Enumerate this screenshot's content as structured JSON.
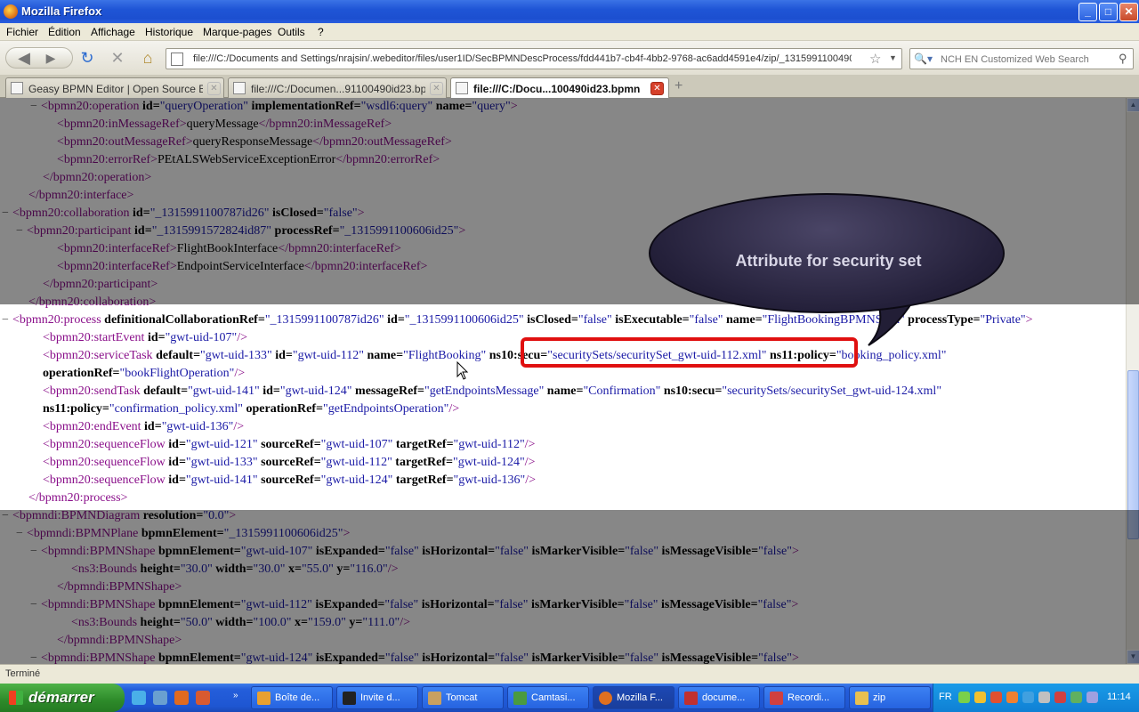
{
  "window": {
    "title": "Mozilla Firefox",
    "minimize": "_",
    "maximize": "□",
    "close": "✕"
  },
  "menu": [
    "Fichier",
    "Édition",
    "Affichage",
    "Historique",
    "Marque-pages",
    "Outils",
    "?"
  ],
  "nav": {
    "url": "file:///C:/Documents and Settings/nrajsin/.webeditor/files/user1ID/SecBPMNDescProcess/fdd441b7-cb4f-4bb2-9768-ac6add4591e4/zip/_1315991100490id23",
    "search_placeholder": "NCH EN Customized Web Search"
  },
  "tabs": [
    {
      "label": "Geasy BPMN Editor | Open Source BPM..."
    },
    {
      "label": "file:///C:/Documen...91100490id23.bpmn"
    },
    {
      "label": "file:///C:/Docu...100490id23.bpmn"
    }
  ],
  "callout": {
    "text": "Attribute for security set"
  },
  "status": "Terminé",
  "taskbar": {
    "start": "démarrer",
    "buttons": [
      "Boîte de...",
      "Invite d...",
      "Tomcat",
      "Camtasi...",
      "Mozilla F...",
      "docume...",
      "Recordi...",
      "zip"
    ],
    "lang": "FR",
    "clock": "11:14"
  },
  "lines": [
    {
      "m": "−",
      "t": [
        [
          "t",
          "<bpmn20:operation"
        ],
        [
          "a",
          " id="
        ],
        [
          "v",
          "\"queryOperation\""
        ],
        [
          "a",
          " implementationRef="
        ],
        [
          "v",
          "\"wsdl6:query\""
        ],
        [
          "a",
          " name="
        ],
        [
          "v",
          "\"query\""
        ],
        [
          "t",
          ">"
        ]
      ]
    },
    {
      "m": "",
      "t": [
        [
          "t",
          "<bpmn20:inMessageRef>"
        ],
        [
          "x",
          "queryMessage"
        ],
        [
          "t",
          "</bpmn20:inMessageRef>"
        ]
      ]
    },
    {
      "m": "",
      "t": [
        [
          "t",
          "<bpmn20:outMessageRef>"
        ],
        [
          "x",
          "queryResponseMessage"
        ],
        [
          "t",
          "</bpmn20:outMessageRef>"
        ]
      ]
    },
    {
      "m": "",
      "t": [
        [
          "t",
          "<bpmn20:errorRef>"
        ],
        [
          "x",
          "PEtALSWebServiceExceptionError"
        ],
        [
          "t",
          "</bpmn20:errorRef>"
        ]
      ]
    },
    {
      "m": "",
      "t": [
        [
          "t",
          "</bpmn20:operation>"
        ]
      ]
    },
    {
      "m": "",
      "t": [
        [
          "t",
          "</bpmn20:interface>"
        ]
      ]
    },
    {
      "m": "−",
      "t": [
        [
          "t",
          "<bpmn20:collaboration"
        ],
        [
          "a",
          " id="
        ],
        [
          "v",
          "\"_1315991100787id26\""
        ],
        [
          "a",
          " isClosed="
        ],
        [
          "v",
          "\"false\""
        ],
        [
          "t",
          ">"
        ]
      ]
    },
    {
      "m": "−",
      "t": [
        [
          "t",
          "<bpmn20:participant"
        ],
        [
          "a",
          " id="
        ],
        [
          "v",
          "\"_1315991572824id87\""
        ],
        [
          "a",
          " processRef="
        ],
        [
          "v",
          "\"_1315991100606id25\""
        ],
        [
          "t",
          ">"
        ]
      ]
    },
    {
      "m": "",
      "t": [
        [
          "t",
          "<bpmn20:interfaceRef>"
        ],
        [
          "x",
          "FlightBookInterface"
        ],
        [
          "t",
          "</bpmn20:interfaceRef>"
        ]
      ]
    },
    {
      "m": "",
      "t": [
        [
          "t",
          "<bpmn20:interfaceRef>"
        ],
        [
          "x",
          "EndpointServiceInterface"
        ],
        [
          "t",
          "</bpmn20:interfaceRef>"
        ]
      ]
    },
    {
      "m": "",
      "t": [
        [
          "t",
          "</bpmn20:participant>"
        ]
      ]
    },
    {
      "m": "",
      "t": [
        [
          "t",
          "</bpmn20:collaboration>"
        ]
      ]
    },
    {
      "m": "−",
      "t": [
        [
          "t",
          "<bpmn20:process"
        ],
        [
          "a",
          " definitionalCollaborationRef="
        ],
        [
          "v",
          "\"_1315991100787id26\""
        ],
        [
          "a",
          " id="
        ],
        [
          "v",
          "\"_1315991100606id25\""
        ],
        [
          "a",
          " isClosed="
        ],
        [
          "v",
          "\"false\""
        ],
        [
          "a",
          " isExecutable="
        ],
        [
          "v",
          "\"false\""
        ],
        [
          "a",
          " name="
        ],
        [
          "v",
          "\"FlightBookingBPMNSecu\""
        ],
        [
          "a",
          " processType="
        ],
        [
          "v",
          "\"Private\""
        ],
        [
          "t",
          ">"
        ]
      ]
    },
    {
      "m": "",
      "t": [
        [
          "t",
          "<bpmn20:startEvent"
        ],
        [
          "a",
          " id="
        ],
        [
          "v",
          "\"gwt-uid-107\""
        ],
        [
          "t",
          "/>"
        ]
      ]
    },
    {
      "m": "",
      "t": [
        [
          "t",
          "<bpmn20:serviceTask"
        ],
        [
          "a",
          " default="
        ],
        [
          "v",
          "\"gwt-uid-133\""
        ],
        [
          "a",
          " id="
        ],
        [
          "v",
          "\"gwt-uid-112\""
        ],
        [
          "a",
          " name="
        ],
        [
          "v",
          "\"FlightBooking\""
        ],
        [
          "a",
          " ns10:secu="
        ],
        [
          "v",
          "\"securitySets/securitySet_gwt-uid-112.xml\""
        ],
        [
          "a",
          " ns11:policy="
        ],
        [
          "v",
          "\"booking_policy.xml\""
        ]
      ]
    },
    {
      "m": "",
      "t": [
        [
          "a",
          "operationRef="
        ],
        [
          "v",
          "\"bookFlightOperation\""
        ],
        [
          "t",
          "/>"
        ]
      ]
    },
    {
      "m": "",
      "t": [
        [
          "t",
          "<bpmn20:sendTask"
        ],
        [
          "a",
          " default="
        ],
        [
          "v",
          "\"gwt-uid-141\""
        ],
        [
          "a",
          " id="
        ],
        [
          "v",
          "\"gwt-uid-124\""
        ],
        [
          "a",
          " messageRef="
        ],
        [
          "v",
          "\"getEndpointsMessage\""
        ],
        [
          "a",
          " name="
        ],
        [
          "v",
          "\"Confirmation\""
        ],
        [
          "a",
          " ns10:secu="
        ],
        [
          "v",
          "\"securitySets/securitySet_gwt-uid-124.xml\""
        ]
      ]
    },
    {
      "m": "",
      "t": [
        [
          "a",
          "ns11:policy="
        ],
        [
          "v",
          "\"confirmation_policy.xml\""
        ],
        [
          "a",
          " operationRef="
        ],
        [
          "v",
          "\"getEndpointsOperation\""
        ],
        [
          "t",
          "/>"
        ]
      ]
    },
    {
      "m": "",
      "t": [
        [
          "t",
          "<bpmn20:endEvent"
        ],
        [
          "a",
          " id="
        ],
        [
          "v",
          "\"gwt-uid-136\""
        ],
        [
          "t",
          "/>"
        ]
      ]
    },
    {
      "m": "",
      "t": [
        [
          "t",
          "<bpmn20:sequenceFlow"
        ],
        [
          "a",
          " id="
        ],
        [
          "v",
          "\"gwt-uid-121\""
        ],
        [
          "a",
          " sourceRef="
        ],
        [
          "v",
          "\"gwt-uid-107\""
        ],
        [
          "a",
          " targetRef="
        ],
        [
          "v",
          "\"gwt-uid-112\""
        ],
        [
          "t",
          "/>"
        ]
      ]
    },
    {
      "m": "",
      "t": [
        [
          "t",
          "<bpmn20:sequenceFlow"
        ],
        [
          "a",
          " id="
        ],
        [
          "v",
          "\"gwt-uid-133\""
        ],
        [
          "a",
          " sourceRef="
        ],
        [
          "v",
          "\"gwt-uid-112\""
        ],
        [
          "a",
          " targetRef="
        ],
        [
          "v",
          "\"gwt-uid-124\""
        ],
        [
          "t",
          "/>"
        ]
      ]
    },
    {
      "m": "",
      "t": [
        [
          "t",
          "<bpmn20:sequenceFlow"
        ],
        [
          "a",
          " id="
        ],
        [
          "v",
          "\"gwt-uid-141\""
        ],
        [
          "a",
          " sourceRef="
        ],
        [
          "v",
          "\"gwt-uid-124\""
        ],
        [
          "a",
          " targetRef="
        ],
        [
          "v",
          "\"gwt-uid-136\""
        ],
        [
          "t",
          "/>"
        ]
      ]
    },
    {
      "m": "",
      "t": [
        [
          "t",
          "</bpmn20:process>"
        ]
      ]
    },
    {
      "m": "−",
      "t": [
        [
          "t",
          "<bpmndi:BPMNDiagram"
        ],
        [
          "a",
          " resolution="
        ],
        [
          "v",
          "\"0.0\""
        ],
        [
          "t",
          ">"
        ]
      ]
    },
    {
      "m": "−",
      "t": [
        [
          "t",
          "<bpmndi:BPMNPlane"
        ],
        [
          "a",
          " bpmnElement="
        ],
        [
          "v",
          "\"_1315991100606id25\""
        ],
        [
          "t",
          ">"
        ]
      ]
    },
    {
      "m": "−",
      "t": [
        [
          "t",
          "<bpmndi:BPMNShape"
        ],
        [
          "a",
          " bpmnElement="
        ],
        [
          "v",
          "\"gwt-uid-107\""
        ],
        [
          "a",
          " isExpanded="
        ],
        [
          "v",
          "\"false\""
        ],
        [
          "a",
          " isHorizontal="
        ],
        [
          "v",
          "\"false\""
        ],
        [
          "a",
          " isMarkerVisible="
        ],
        [
          "v",
          "\"false\""
        ],
        [
          "a",
          " isMessageVisible="
        ],
        [
          "v",
          "\"false\""
        ],
        [
          "t",
          ">"
        ]
      ]
    },
    {
      "m": "",
      "t": [
        [
          "t",
          "<ns3:Bounds"
        ],
        [
          "a",
          " height="
        ],
        [
          "v",
          "\"30.0\""
        ],
        [
          "a",
          " width="
        ],
        [
          "v",
          "\"30.0\""
        ],
        [
          "a",
          " x="
        ],
        [
          "v",
          "\"55.0\""
        ],
        [
          "a",
          " y="
        ],
        [
          "v",
          "\"116.0\""
        ],
        [
          "t",
          "/>"
        ]
      ]
    },
    {
      "m": "",
      "t": [
        [
          "t",
          "</bpmndi:BPMNShape>"
        ]
      ]
    },
    {
      "m": "−",
      "t": [
        [
          "t",
          "<bpmndi:BPMNShape"
        ],
        [
          "a",
          " bpmnElement="
        ],
        [
          "v",
          "\"gwt-uid-112\""
        ],
        [
          "a",
          " isExpanded="
        ],
        [
          "v",
          "\"false\""
        ],
        [
          "a",
          " isHorizontal="
        ],
        [
          "v",
          "\"false\""
        ],
        [
          "a",
          " isMarkerVisible="
        ],
        [
          "v",
          "\"false\""
        ],
        [
          "a",
          " isMessageVisible="
        ],
        [
          "v",
          "\"false\""
        ],
        [
          "t",
          ">"
        ]
      ]
    },
    {
      "m": "",
      "t": [
        [
          "t",
          "<ns3:Bounds"
        ],
        [
          "a",
          " height="
        ],
        [
          "v",
          "\"50.0\""
        ],
        [
          "a",
          " width="
        ],
        [
          "v",
          "\"100.0\""
        ],
        [
          "a",
          " x="
        ],
        [
          "v",
          "\"159.0\""
        ],
        [
          "a",
          " y="
        ],
        [
          "v",
          "\"111.0\""
        ],
        [
          "t",
          "/>"
        ]
      ]
    },
    {
      "m": "",
      "t": [
        [
          "t",
          "</bpmndi:BPMNShape>"
        ]
      ]
    },
    {
      "m": "−",
      "t": [
        [
          "t",
          "<bpmndi:BPMNShape"
        ],
        [
          "a",
          " bpmnElement="
        ],
        [
          "v",
          "\"gwt-uid-124\""
        ],
        [
          "a",
          " isExpanded="
        ],
        [
          "v",
          "\"false\""
        ],
        [
          "a",
          " isHorizontal="
        ],
        [
          "v",
          "\"false\""
        ],
        [
          "a",
          " isMarkerVisible="
        ],
        [
          "v",
          "\"false\""
        ],
        [
          "a",
          " isMessageVisible="
        ],
        [
          "v",
          "\"false\""
        ],
        [
          "t",
          ">"
        ]
      ]
    }
  ]
}
